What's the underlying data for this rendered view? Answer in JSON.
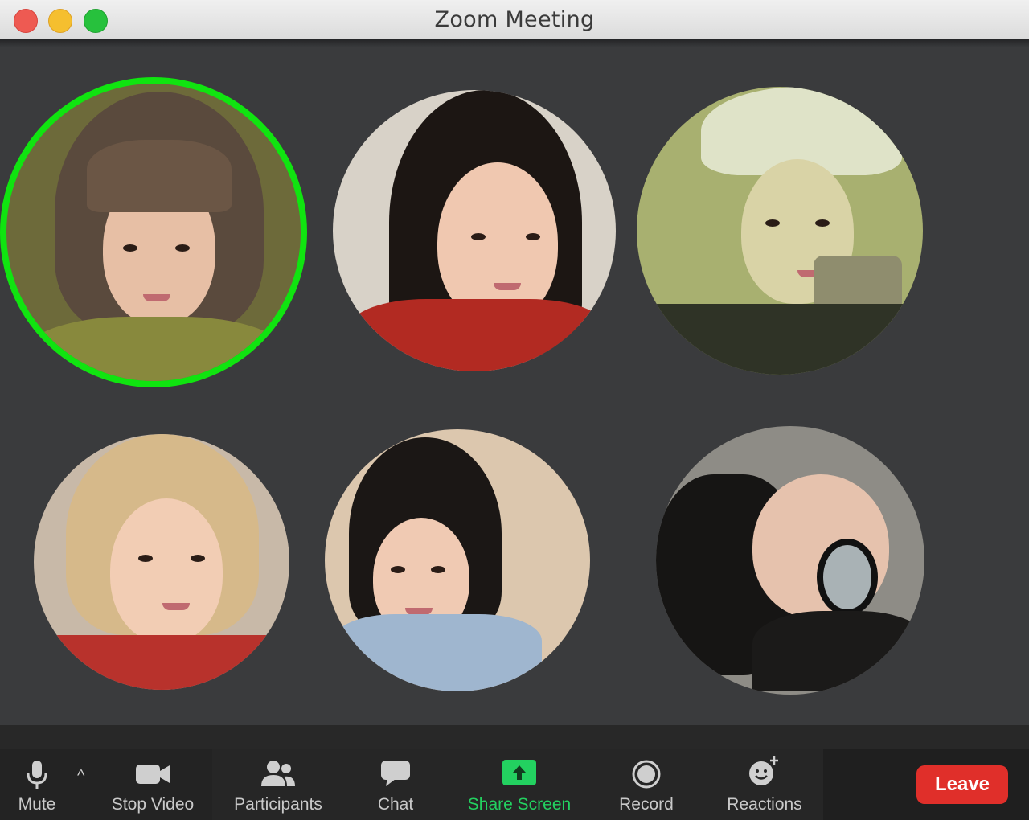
{
  "window": {
    "title": "Zoom Meeting"
  },
  "participants": [
    {
      "id": "p1",
      "speaking": true
    },
    {
      "id": "p2",
      "speaking": false
    },
    {
      "id": "p3",
      "speaking": false
    },
    {
      "id": "p4",
      "speaking": false
    },
    {
      "id": "p5",
      "speaking": false
    },
    {
      "id": "p6",
      "speaking": false
    }
  ],
  "toolbar": {
    "mute_label": "Mute",
    "stop_video_label": "Stop Video",
    "participants_label": "Participants",
    "chat_label": "Chat",
    "share_screen_label": "Share Screen",
    "record_label": "Record",
    "reactions_label": "Reactions",
    "leave_label": "Leave",
    "caret_glyph": "^"
  },
  "colors": {
    "active_speaker_ring": "#10e410",
    "share_screen_accent": "#23d160",
    "leave_button": "#e02f2a"
  }
}
